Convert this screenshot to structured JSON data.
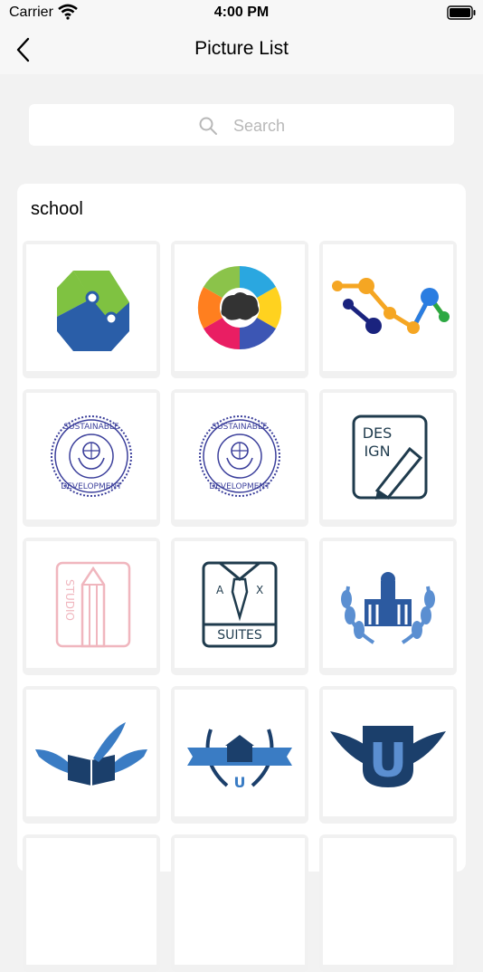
{
  "status_bar": {
    "carrier": "Carrier",
    "time": "4:00 PM"
  },
  "nav": {
    "title": "Picture List"
  },
  "search": {
    "placeholder": "Search"
  },
  "section": {
    "title": "school",
    "logos": {
      "sustainable_top": "SUSTAINABLE",
      "sustainable_bottom": "DEVELOPMENT",
      "design_1": "DES",
      "design_2": "IGN",
      "studio": "STUDIO",
      "suites_a": "A",
      "suites_x": "X",
      "suites_label": "SUITES",
      "u_letter": "U"
    }
  },
  "colors": {
    "blue": "#2a5ea8",
    "navy": "#1b3f6b",
    "pink": "#f0b6be",
    "green": "#7fc241"
  }
}
